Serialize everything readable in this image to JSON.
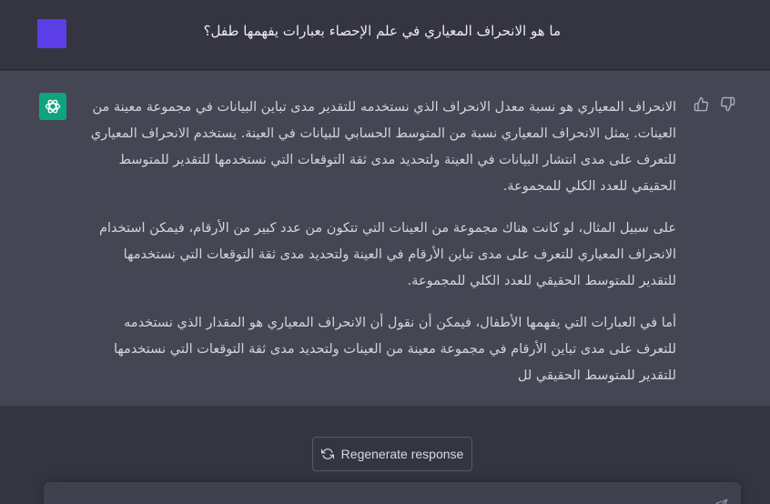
{
  "user_message": {
    "text": "ما هو الانحراف المعياري في علم الإحصاء بعبارات يفهمها طفل؟",
    "avatar_color": "#5b3ee6"
  },
  "assistant_message": {
    "avatar_icon": "openai-logo-icon",
    "avatar_color": "#10a37f",
    "paragraphs": [
      "الانحراف المعياري هو نسبة معدل الانحراف الذي نستخدمه للتقدير مدى تباين البيانات في مجموعة معينة من العينات. يمثل الانحراف المعياري نسبة من المتوسط الحسابي للبيانات في العينة. يستخدم الانحراف المعياري للتعرف على مدى انتشار البيانات في العينة ولتحديد مدى ثقة التوقعات التي نستخدمها للتقدير للمتوسط الحقيقي للعدد الكلي للمجموعة.",
      "على سبيل المثال، لو كانت هناك مجموعة من العينات التي تتكون من عدد كبير من الأرقام، فيمكن استخدام الانحراف المعياري للتعرف على مدى تباين الأرقام في العينة ولتحديد مدى ثقة التوقعات التي نستخدمها للتقدير للمتوسط الحقيقي للعدد الكلي للمجموعة.",
      "أما في العبارات التي يفهمها الأطفال، فيمكن أن نقول أن الانحراف المعياري هو المقدار الذي نستخدمه للتعرف على مدى تباين الأرقام في مجموعة معينة من العينات ولتحديد مدى ثقة التوقعات التي نستخدمها للتقدير للمتوسط الحقيقي لل"
    ],
    "feedback_icons": [
      "thumbs-up-icon",
      "thumbs-down-icon"
    ]
  },
  "regenerate_button": {
    "label": "Regenerate response",
    "icon": "refresh-icon"
  },
  "composer": {
    "send_icon": "send-icon"
  },
  "colors": {
    "background": "#343541",
    "assistant_background": "#444654",
    "text": "#d1d5db"
  }
}
